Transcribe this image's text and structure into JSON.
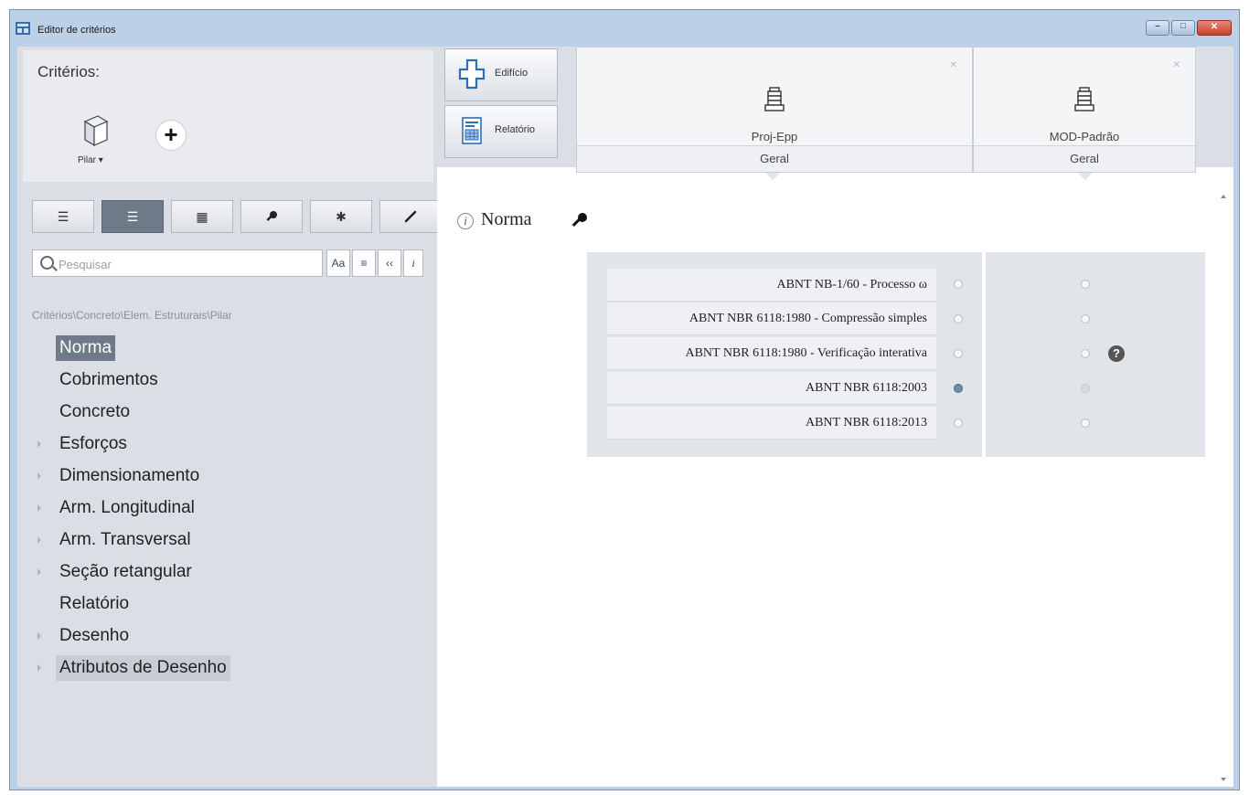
{
  "window": {
    "title": "Editor de critérios"
  },
  "left": {
    "criteria_title": "Critérios:",
    "element_label": "Pilar",
    "search": {
      "placeholder": "Pesquisar",
      "options": [
        "Aa",
        "≡",
        "‹‹",
        "i"
      ]
    },
    "breadcrumb": "Critérios\\Concreto\\Elem. Estruturais\\Pilar",
    "tree": [
      {
        "label": "Norma",
        "expandable": false,
        "state": "selected"
      },
      {
        "label": "Cobrimentos",
        "expandable": false
      },
      {
        "label": "Concreto",
        "expandable": false
      },
      {
        "label": "Esforços",
        "expandable": true
      },
      {
        "label": "Dimensionamento",
        "expandable": true
      },
      {
        "label": "Arm. Longitudinal",
        "expandable": true
      },
      {
        "label": "Arm. Transversal",
        "expandable": true
      },
      {
        "label": "Seção retangular",
        "expandable": true
      },
      {
        "label": "Relatório",
        "expandable": false
      },
      {
        "label": "Desenho",
        "expandable": true
      },
      {
        "label": "Atributos de Desenho",
        "expandable": true,
        "state": "hover"
      }
    ]
  },
  "right": {
    "buttons": {
      "building": "Edifício",
      "report": "Relatório"
    },
    "columns": [
      {
        "name": "Proj-Epp",
        "sub": "Geral"
      },
      {
        "name": "MOD-Padrão",
        "sub": "Geral"
      }
    ],
    "section_title": "Norma",
    "options": [
      {
        "label": "ABNT NB-1/60 - Processo ω",
        "col1": "off",
        "col2": "off"
      },
      {
        "label": "ABNT NBR 6118:1980 - Compressão simples",
        "col1": "off",
        "col2": "off"
      },
      {
        "label": "ABNT NBR 6118:1980 - Verificação interativa",
        "col1": "off",
        "col2": "off"
      },
      {
        "label": "ABNT NBR 6118:2003",
        "col1": "on",
        "col2": "disabled"
      },
      {
        "label": "ABNT NBR 6118:2013",
        "col1": "off",
        "col2": "off"
      }
    ],
    "help_icon": "?"
  }
}
